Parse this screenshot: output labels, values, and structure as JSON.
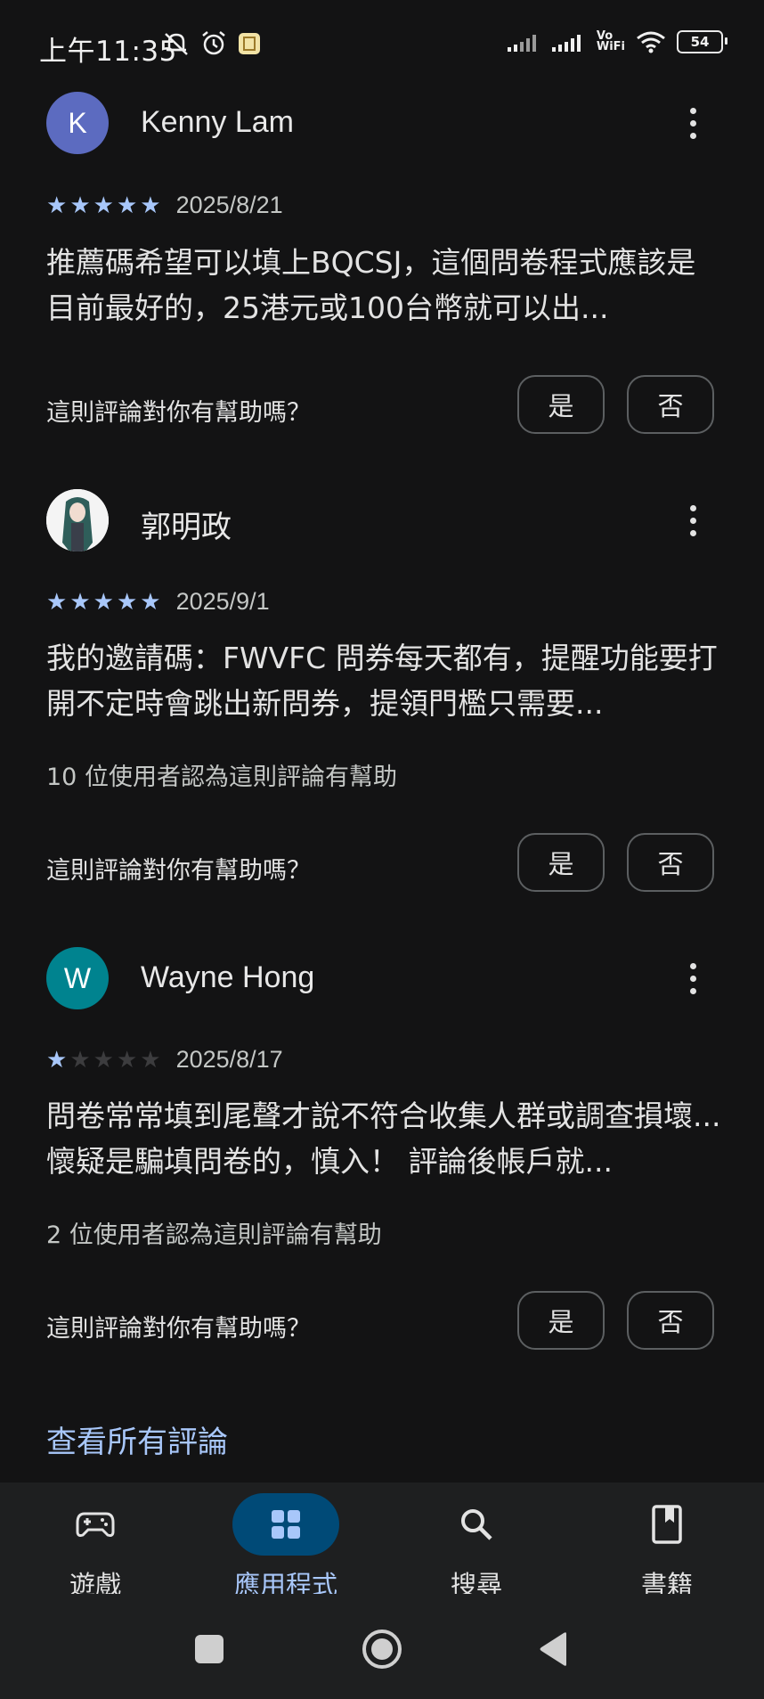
{
  "status_bar": {
    "time": "上午11:35",
    "battery": "54",
    "vowifi_top": "Vo",
    "vowifi_bottom": "WiFi"
  },
  "reviews": [
    {
      "avatar_letter": "K",
      "avatar_color": "#5c6bc0",
      "name": "Kenny Lam",
      "stars": 5,
      "date": "2025/8/21",
      "text": "推薦碼希望可以填上BQCSJ，這個問卷程式應該是目前最好的，25港元或100台幣就可以出...",
      "helpful_count": "",
      "helpful_question": "這則評論對你有幫助嗎？",
      "yes": "是",
      "no": "否"
    },
    {
      "avatar_letter": "",
      "avatar_color": "#ffffff",
      "name": "郭明政",
      "stars": 5,
      "date": "2025/9/1",
      "text": "我的邀請碼：FWVFC 問券每天都有，提醒功能要打開不定時會跳出新問券，提領門檻只需要...",
      "helpful_count": "10 位使用者認為這則評論有幫助",
      "helpful_question": "這則評論對你有幫助嗎？",
      "yes": "是",
      "no": "否"
    },
    {
      "avatar_letter": "W",
      "avatar_color": "#00838f",
      "name": "Wayne Hong",
      "stars": 1,
      "date": "2025/8/17",
      "text": "問卷常常填到尾聲才說不符合收集人群或調查損壞...懷疑是騙填問卷的，慎入！ 評論後帳戶就...",
      "helpful_count": "2 位使用者認為這則評論有幫助",
      "helpful_question": "這則評論對你有幫助嗎？",
      "yes": "是",
      "no": "否"
    }
  ],
  "see_all_reviews": "查看所有評論",
  "bottom_nav": {
    "items": [
      {
        "label": "遊戲",
        "icon": "gamepad-icon",
        "active": false
      },
      {
        "label": "應用程式",
        "icon": "apps-grid-icon",
        "active": true
      },
      {
        "label": "搜尋",
        "icon": "search-icon",
        "active": false
      },
      {
        "label": "書籍",
        "icon": "book-icon",
        "active": false
      }
    ]
  },
  "colors": {
    "background": "#131314",
    "accent": "#a8c7fa",
    "active_pill": "#004a77",
    "nav_bg": "#1e1f20"
  }
}
